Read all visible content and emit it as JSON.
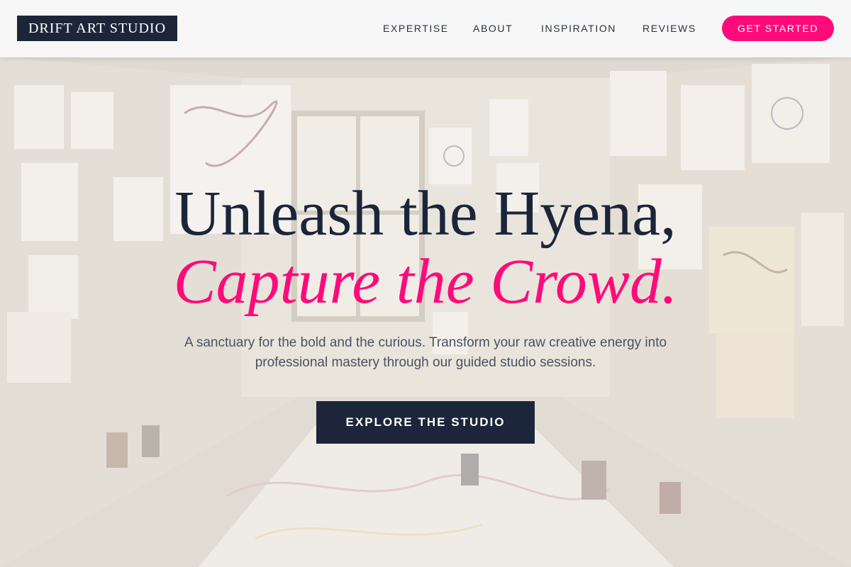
{
  "brand": {
    "logo": "DRIFT ART STUDIO"
  },
  "nav": {
    "items": [
      {
        "label": "EXPERTISE"
      },
      {
        "label": "ABOUT"
      },
      {
        "label": "INSPIRATION"
      },
      {
        "label": "REVIEWS"
      }
    ],
    "cta_label": "GET STARTED"
  },
  "hero": {
    "line1": "Unleash the Hyena,",
    "line2": "Capture the Crowd.",
    "subtitle": "A sanctuary for the bold and the curious. Transform your raw creative energy into professional mastery through our guided studio sessions.",
    "cta_label": "EXPLORE THE STUDIO"
  },
  "colors": {
    "navy": "#1c2539",
    "accent_pink": "#ff0a7a",
    "header_bg": "#f8f8f8",
    "body_text": "#4a5262"
  },
  "background": {
    "description_icon": "studio-photo-image"
  }
}
